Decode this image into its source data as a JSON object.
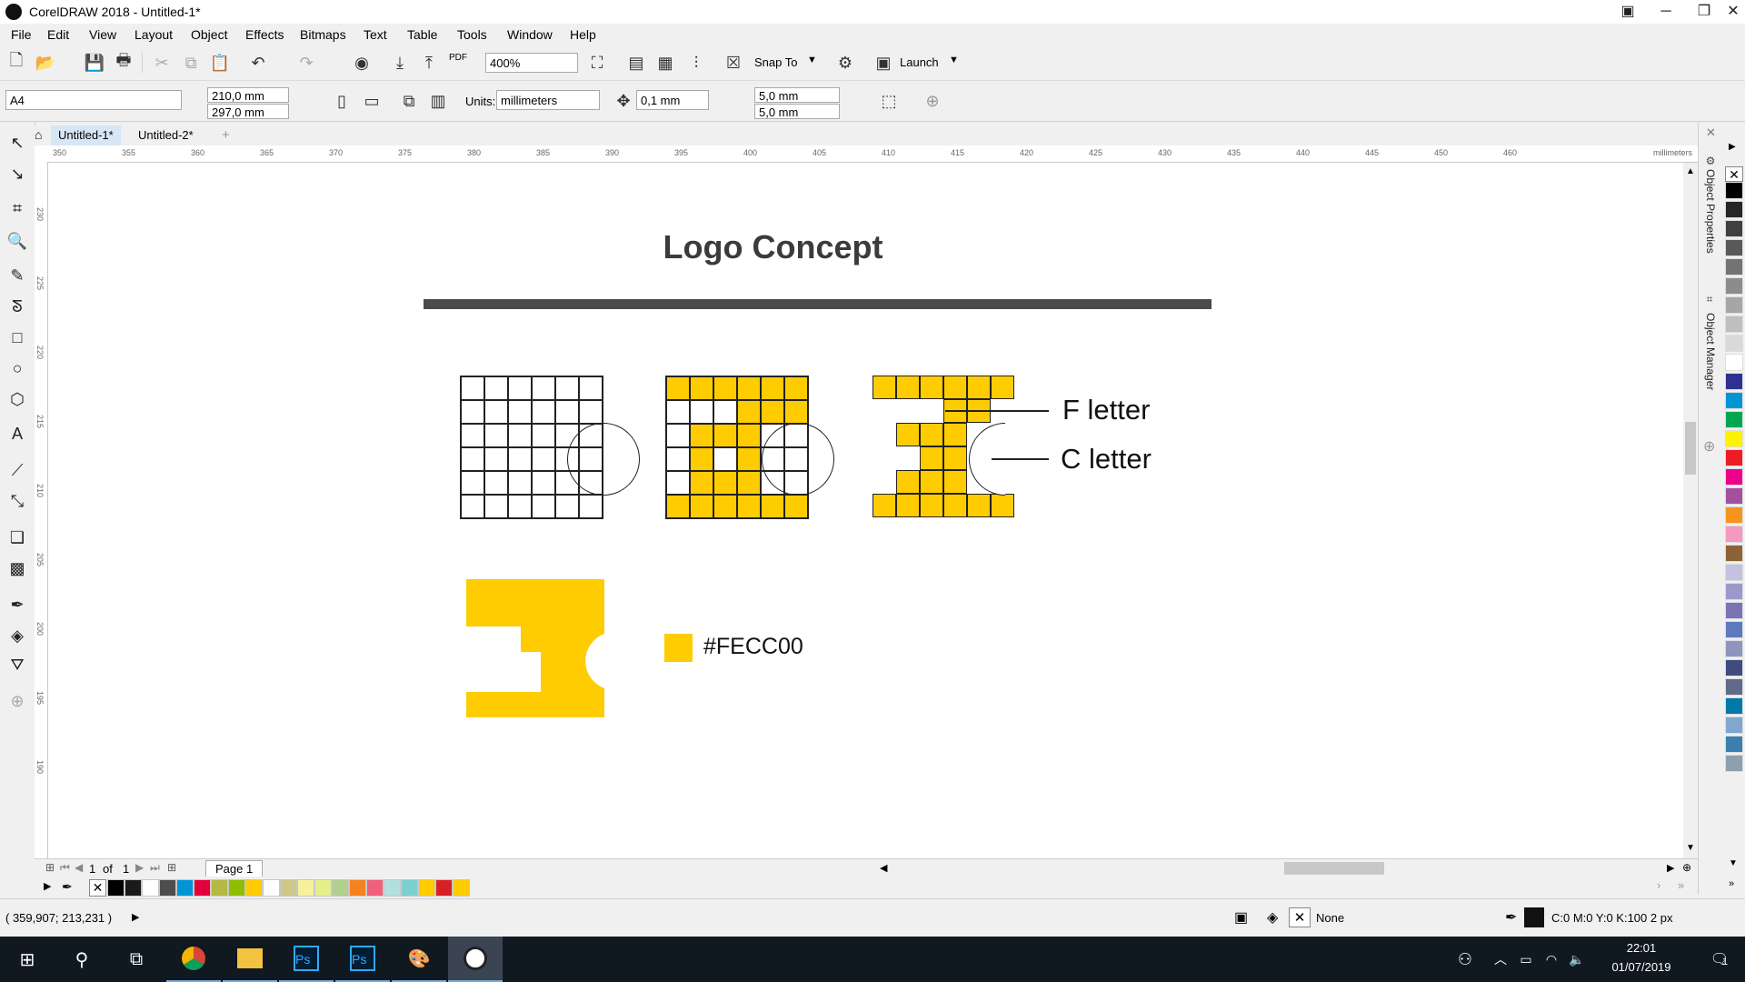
{
  "window": {
    "title": "CorelDRAW 2018 - Untitled-1*"
  },
  "menu": [
    "File",
    "Edit",
    "View",
    "Layout",
    "Object",
    "Effects",
    "Bitmaps",
    "Text",
    "Table",
    "Tools",
    "Window",
    "Help"
  ],
  "toolbar1": {
    "zoom": "400%",
    "snap_to": "Snap To",
    "launch": "Launch",
    "pdf": "PDF"
  },
  "toolbar2": {
    "page_size": "A4",
    "width": "210,0 mm",
    "height": "297,0 mm",
    "units_label": "Units:",
    "units": "millimeters",
    "nudge": "0,1 mm",
    "dup_x": "5,0 mm",
    "dup_y": "5,0 mm"
  },
  "tabs": [
    "Untitled-1*",
    "Untitled-2*"
  ],
  "ruler": {
    "unit": "millimeters",
    "top_ticks": [
      "350",
      "355",
      "360",
      "365",
      "370",
      "375",
      "380",
      "385",
      "390",
      "395",
      "400",
      "405",
      "410",
      "415",
      "420",
      "425",
      "430",
      "435",
      "440",
      "445",
      "450",
      "460"
    ],
    "left_ticks": [
      "230",
      "225",
      "220",
      "215",
      "210",
      "205",
      "200",
      "195",
      "190"
    ]
  },
  "artwork": {
    "title": "Logo Concept",
    "label_f": "F letter",
    "label_c": "C letter",
    "swatch_hex": "#FECC00",
    "brand_color": "#FECC00",
    "grid2_fill": [
      [
        1,
        1,
        1,
        1,
        1,
        1
      ],
      [
        0,
        0,
        0,
        1,
        1,
        1
      ],
      [
        0,
        1,
        1,
        1,
        0,
        0
      ],
      [
        0,
        1,
        0,
        1,
        0,
        0
      ],
      [
        0,
        1,
        1,
        1,
        0,
        0
      ],
      [
        1,
        1,
        1,
        1,
        1,
        1
      ]
    ],
    "grid3_fill": [
      [
        1,
        1,
        1,
        1,
        1,
        1
      ],
      [
        0,
        0,
        0,
        1,
        1,
        0
      ],
      [
        0,
        1,
        1,
        1,
        0,
        0
      ],
      [
        0,
        0,
        1,
        1,
        0,
        0
      ],
      [
        0,
        1,
        1,
        1,
        0,
        0
      ],
      [
        1,
        1,
        1,
        1,
        1,
        1
      ]
    ]
  },
  "page_nav": {
    "current": "1",
    "of_label": "of",
    "total": "1",
    "page_tab": "Page 1"
  },
  "status": {
    "coords": "( 359,907; 213,231 )",
    "fill": "None",
    "outline": "C:0 M:0 Y:0 K:100  2 px"
  },
  "dockers": [
    "Object Properties",
    "Object Manager"
  ],
  "taskbar": {
    "time": "22:01",
    "date": "01/07/2019",
    "notification_count": "1"
  },
  "palette_bottom": [
    "#000000",
    "#1a1a1a",
    "#ffffff",
    "#4d4d4d",
    "#0095d5",
    "#e4003a",
    "#b5b943",
    "#8fbe00",
    "#fecc00",
    "#ffffff",
    "#cdc78a",
    "#f6f19c",
    "#e5ef8c",
    "#b2d08e",
    "#f58220",
    "#ef6079",
    "#b2e0e0",
    "#7dcfcf",
    "#fecc00",
    "#d91f26",
    "#fecc00"
  ],
  "palette_right": [
    "#000000",
    "#262626",
    "#404040",
    "#595959",
    "#737373",
    "#8c8c8c",
    "#a6a6a6",
    "#bfbfbf",
    "#d9d9d9",
    "#ffffff",
    "#2e3192",
    "#0095d5",
    "#00a651",
    "#fff200",
    "#ed1c24",
    "#ec008c",
    "#a3519f",
    "#f7941d",
    "#f49ac1",
    "#8c6239",
    "#c4c2e0",
    "#9d98cc",
    "#7c73b5",
    "#5e79be",
    "#8f94c0",
    "#414b7f",
    "#626a8c",
    "#0078a8",
    "#7fa7d0",
    "#3c7fae",
    "#8d9fae"
  ]
}
